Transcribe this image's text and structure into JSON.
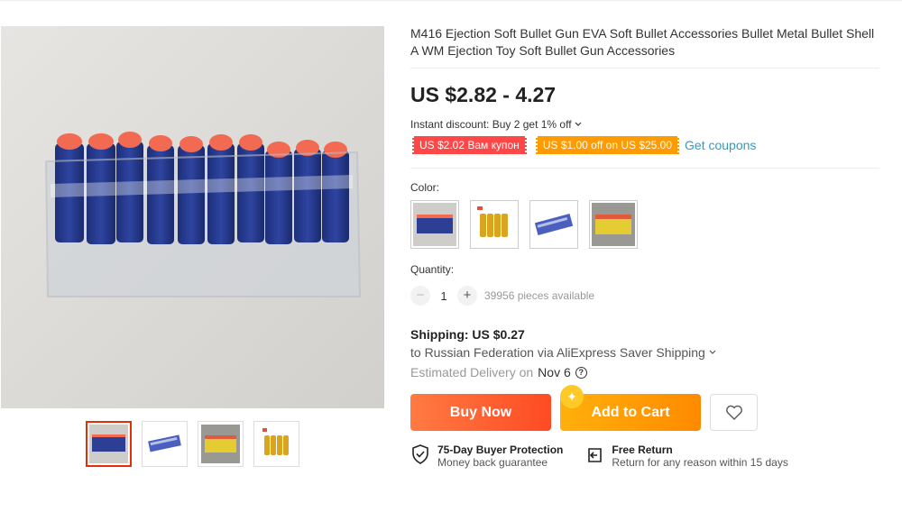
{
  "product": {
    "title": "M416 Ejection Soft Bullet Gun EVA Soft Bullet Accessories Bullet Metal Bullet Shell A WM Ejection Toy Soft Bullet Gun Accessories",
    "price": "US $2.82 - 4.27",
    "instant_discount": "Instant discount: Buy 2 get 1% off",
    "coupons": [
      "US $2.02 Вам купон",
      "US $1.00 off on US $25.00"
    ],
    "get_coupons": "Get coupons",
    "color_label": "Color:",
    "quantity_label": "Quantity:",
    "quantity_value": "1",
    "quantity_minus": "−",
    "quantity_plus": "+",
    "available": "39956 pieces available"
  },
  "shipping": {
    "cost": "Shipping: US $0.27",
    "destination": "to Russian Federation via AliExpress Saver Shipping",
    "estimated_label": "Estimated Delivery on",
    "estimated_date": "Nov 6"
  },
  "actions": {
    "buy_now": "Buy Now",
    "add_to_cart": "Add to Cart"
  },
  "guarantees": [
    {
      "title": "75-Day Buyer Protection",
      "subtitle": "Money back guarantee",
      "icon": "shield-check-icon"
    },
    {
      "title": "Free Return",
      "subtitle": "Return for any reason within 15 days",
      "icon": "return-arrow-icon"
    }
  ],
  "colors": {
    "accent_red": "#ff4b24",
    "accent_orange": "#ff8a00",
    "link_blue": "#2e9cc3",
    "selected_border": "#e62e04"
  }
}
